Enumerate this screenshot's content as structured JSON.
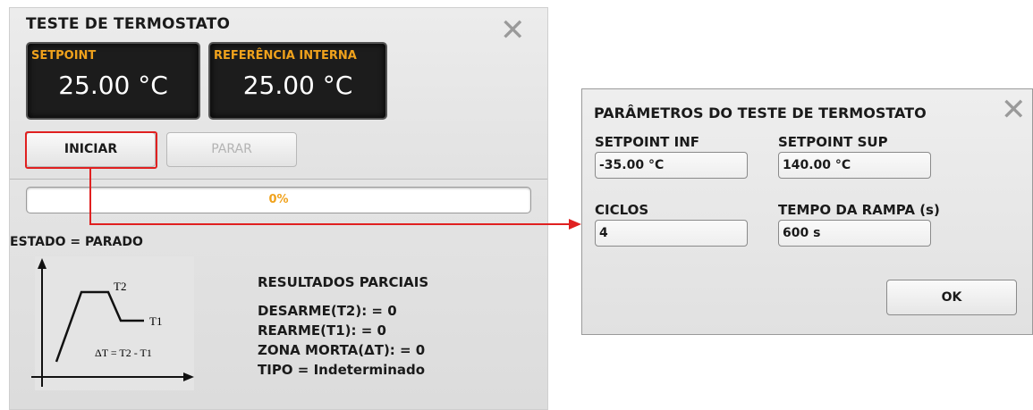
{
  "thermostat_test": {
    "title": "TESTE DE TERMOSTATO",
    "close_glyph": "✕",
    "setpoint": {
      "label": "SETPOINT",
      "value": "25.00 °C"
    },
    "internal_reference": {
      "label": "REFERÊNCIA INTERNA",
      "value": "25.00 °C"
    },
    "start_label": "INICIAR",
    "stop_label": "PARAR",
    "progress": {
      "percent": 0,
      "text": "0%"
    },
    "status": "ESTADO = PARADO",
    "graph": {
      "t2": "T2",
      "t1": "T1",
      "formula": "ΔT = T2 - T1"
    },
    "results": {
      "title": "RESULTADOS PARCIAIS",
      "trip": "DESARME(T2):  = 0",
      "reset": "REARME(T1):  = 0",
      "deadband": "ZONA MORTA(ΔT):  = 0",
      "type": "TIPO = Indeterminado"
    }
  },
  "params_dialog": {
    "title": "PARÂMETROS DO TESTE DE TERMOSTATO",
    "close_glyph": "✕",
    "setpoint_inf": {
      "label": "SETPOINT INF",
      "value": "-35.00 °C"
    },
    "setpoint_sup": {
      "label": "SETPOINT SUP",
      "value": "140.00 °C"
    },
    "cycles": {
      "label": "CICLOS",
      "value": "4"
    },
    "ramp_time": {
      "label": "TEMPO DA RAMPA (s)",
      "value": "600 s"
    },
    "ok_label": "OK"
  },
  "colors": {
    "accent": "#f0a21c",
    "highlight": "#e02020",
    "display_bg": "#1c1c1c"
  }
}
